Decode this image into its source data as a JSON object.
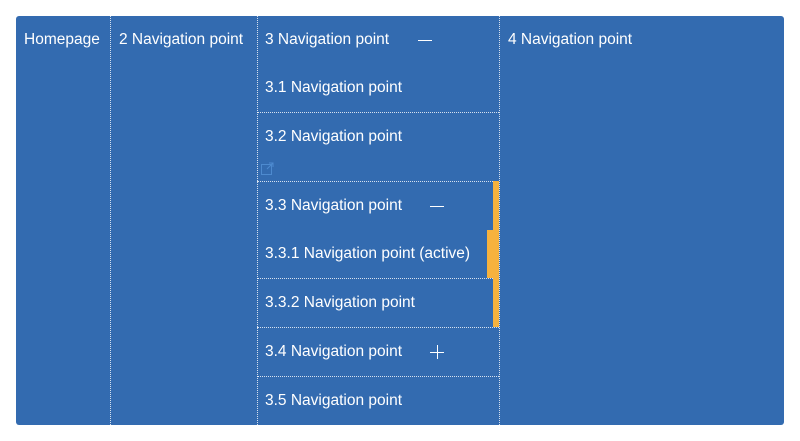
{
  "nav": {
    "items": [
      {
        "label": "Homepage"
      },
      {
        "label": "2 Navigation point"
      },
      {
        "label": "3 Navigation point",
        "toggle_icon": "minus-icon",
        "children": [
          {
            "label": "3.1 Navigation point"
          },
          {
            "label": "3.2 Navigation point",
            "icon": "external-link-icon"
          },
          {
            "label": "3.3 Navigation point",
            "toggle_icon": "minus-icon",
            "children": [
              {
                "label": "3.3.1 Navigation point (active)",
                "active": true
              },
              {
                "label": "3.3.2 Navigation point"
              }
            ]
          },
          {
            "label": "3.4 Navigation point",
            "toggle_icon": "plus-icon"
          },
          {
            "label": "3.5 Navigation point"
          }
        ]
      },
      {
        "label": "4 Navigation point"
      }
    ]
  },
  "colors": {
    "background": "#336bb0",
    "text": "#ffffff",
    "accent": "#f6b23e"
  }
}
